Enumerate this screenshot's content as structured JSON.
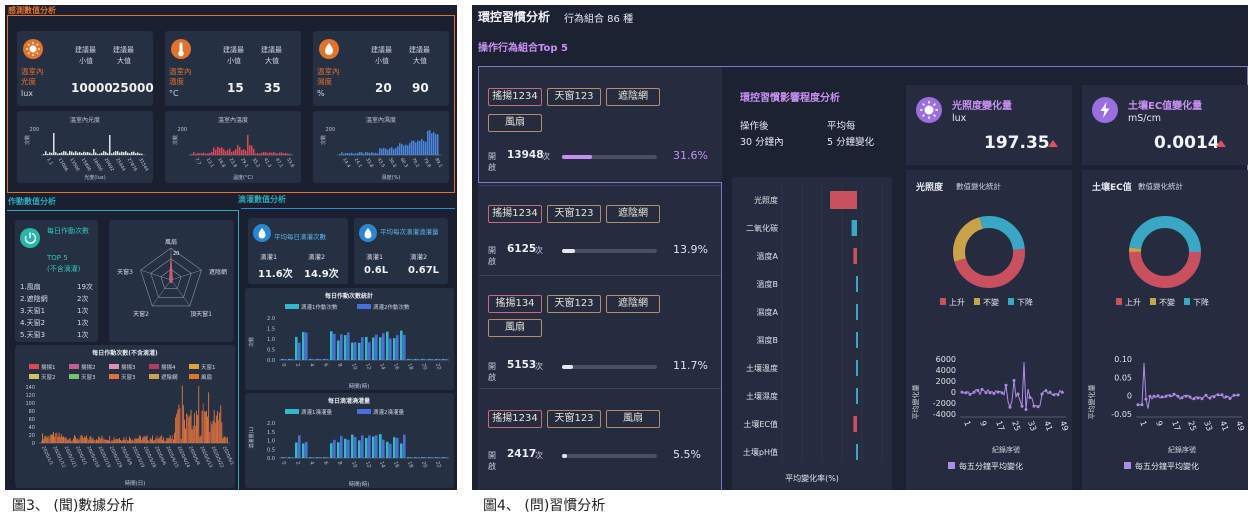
{
  "left": {
    "sec1": "感測數值分析",
    "sensors": [
      {
        "icon": "sun-icon",
        "name": "溫室內\n光度",
        "unit": "lux",
        "min": "10000",
        "max": "25000",
        "color": "#e0742e"
      },
      {
        "icon": "thermometer-icon",
        "name": "溫室內\n溫度",
        "unit": "°C",
        "min": "15",
        "max": "35",
        "color": "#e0742e"
      },
      {
        "icon": "droplet-icon",
        "name": "溫室內\n濕度",
        "unit": "%",
        "min": "20",
        "max": "90",
        "color": "#e0742e"
      }
    ],
    "minLabel": "建議最\n小值",
    "maxLabel": "建議最\n大值",
    "hist": [
      {
        "title": "溫室內光度",
        "y": "次數",
        "ytick": "200",
        "x": "光度(lux)",
        "ticks": [
          "1.1",
          "11086",
          "13500",
          "15890",
          "18400",
          "20692",
          "25944",
          "27878",
          "31544"
        ],
        "color": "#e0e0e0"
      },
      {
        "title": "溫室內溫度",
        "y": "次數",
        "ytick": "200",
        "x": "溫度(°C)",
        "ticks": [
          "7.7",
          "13.1",
          "18.8",
          "23.8",
          "29.1",
          "35.2",
          "41.3",
          "47.1",
          "53.6"
        ],
        "color": "#d9485a"
      },
      {
        "title": "溫室內濕度",
        "y": "次數",
        "ytick": "200",
        "x": "濕度(%)",
        "ticks": [
          "14.4",
          "24.1",
          "33.8",
          "43.5",
          "50.6",
          "60.3",
          "70.2",
          "79.8",
          "89.1"
        ],
        "color": "#4a86e0"
      }
    ],
    "sec2": "作動數值分析",
    "sec3": "滴灌數值分析",
    "daily": {
      "title": "每日作動次數",
      "top": "TOP 5",
      "note": "(不含滴灌)",
      "rows": [
        [
          "1.風扇",
          "19次"
        ],
        [
          "2.遮陰網",
          "2次"
        ],
        [
          "3.天窗1",
          "1次"
        ],
        [
          "4.天窗2",
          "1次"
        ],
        [
          "5.天窗3",
          "1次"
        ]
      ]
    },
    "radar": {
      "labels": [
        "風扇",
        "遮陰網",
        "頂天窗1",
        "天窗2",
        "天窗3"
      ],
      "tick": "20"
    },
    "drip": [
      {
        "title": "平均每日滴灌次數",
        "a": "滴灌1",
        "av": "11.6次",
        "b": "滴灌2",
        "bv": "14.9次"
      },
      {
        "title": "平均每次滴灌澆灌量",
        "a": "滴灌1",
        "av": "0.6L",
        "b": "滴灌2",
        "bv": "0.67L"
      }
    ],
    "bigchart": {
      "title": "每日作動次數(不含滴灌)",
      "legend": [
        "揚揚1",
        "揚揚2",
        "揚揚3",
        "揚揚4",
        "天窗1",
        "天窗2",
        "天窗3",
        "天窗3",
        "遮陰網",
        "風扇"
      ],
      "yticks": [
        "140",
        "120",
        "100",
        "80",
        "60",
        "40",
        "20",
        "0"
      ],
      "x": "時間(日)",
      "dates": [
        "2020/1/1",
        "2020/1/12",
        "2020/1/21",
        "2020/2/1",
        "2020/2/10",
        "2020/2/19",
        "2020/2/29",
        "2020/3/9",
        "2020/3/19",
        "2020/3/28",
        "2020/4/6",
        "2020/4/15",
        "2020/4/24",
        "2020/5/4",
        "2020/5/13",
        "2020/5/22",
        "2020/6/1"
      ]
    },
    "dripc1": {
      "title": "每日作動次數統計",
      "legend": [
        "滴灌1作動次數",
        "滴灌2作動次數"
      ],
      "y": "次數",
      "yticks": [
        "2.0",
        "1.5",
        "1.0",
        "0.5",
        "0.0"
      ],
      "x": "時間(時)",
      "xticks": [
        "0",
        "2",
        "4",
        "6",
        "8",
        "10",
        "12",
        "14",
        "16",
        "18",
        "20",
        "22"
      ]
    },
    "dripc2": {
      "title": "每日滴灌澆灌量",
      "legend": [
        "滴灌1澆灌量",
        "滴灌2澆灌量"
      ],
      "y": "澆灌量(L)",
      "yticks": [
        "2.0",
        "1.5",
        "1.0",
        "0.5",
        "0.0"
      ],
      "x": "時間(時)",
      "xticks": [
        "0",
        "2",
        "4",
        "6",
        "8",
        "10",
        "12",
        "14",
        "16",
        "18",
        "20",
        "22"
      ]
    },
    "caption": "圖3、 (聞)數據分析"
  },
  "right": {
    "title": "環控習慣分析",
    "count": "行為組合 86 種",
    "top5": "操作行為組合Top 5",
    "combos": [
      {
        "chips": [
          "搖揚1234",
          "天窗123",
          "遮陰網",
          "風扇"
        ],
        "label": "開啟",
        "n": "13948",
        "unit": "次",
        "pct": "31.6%",
        "frac": 0.316
      },
      {
        "chips": [
          "搖揚1234",
          "天窗123",
          "遮陰網"
        ],
        "label": "開啟",
        "n": "6125",
        "unit": "次",
        "pct": "13.9%",
        "frac": 0.139
      },
      {
        "chips": [
          "搖揚134",
          "天窗123",
          "遮陰網",
          "風扇"
        ],
        "label": "開啟",
        "n": "5153",
        "unit": "次",
        "pct": "11.7%",
        "frac": 0.117
      },
      {
        "chips": [
          "搖揚1234",
          "天窗123",
          "風扇"
        ],
        "label": "開啟",
        "n": "2417",
        "unit": "次",
        "pct": "5.5%",
        "frac": 0.055
      }
    ],
    "impact": {
      "title": "環控習慣影響程度分析",
      "after": "操作後",
      "afterv": "30 分鐘內",
      "avg": "平均每",
      "avgv": "5 分鐘變化",
      "rows": [
        "光照度",
        "二氧化碳",
        "溫度A",
        "溫度B",
        "濕度A",
        "濕度B",
        "土壤溫度",
        "土壤濕度",
        "土壤EC值",
        "土壤pH值"
      ],
      "vals": [
        0.9,
        0.18,
        0.12,
        0.1,
        0.08,
        0.06,
        0.05,
        0.05,
        0.12,
        0.03
      ],
      "x": "平均變化率(%)"
    },
    "light": {
      "title": "光照度變化量",
      "unit": "lux",
      "value": "197.35",
      "stat": "光照度",
      "statsub": "數值變化統計",
      "legend": [
        "上升",
        "不變",
        "下降"
      ],
      "y": "平均變化量",
      "yticks": [
        "6000",
        "4000",
        "2000",
        "0",
        "-2000",
        "-4000"
      ],
      "x": "紀錄序號",
      "xticks": [
        "1",
        "9",
        "17",
        "25",
        "33",
        "41",
        "49"
      ],
      "lg": "每五分鐘平均變化"
    },
    "ec": {
      "title": "土壤EC值變化量",
      "unit": "mS/cm",
      "value": "0.0014",
      "stat": "土壤EC值",
      "statsub": "數值變化統計",
      "legend": [
        "上升",
        "不變",
        "下降"
      ],
      "y": "平均變化量",
      "yticks": [
        "0.10",
        "0.05",
        "0",
        "-0.05"
      ],
      "x": "紀錄序號",
      "xticks": [
        "1",
        "9",
        "17",
        "25",
        "33",
        "41",
        "49"
      ],
      "lg": "每五分鐘平均變化"
    },
    "caption": "圖4、 (問)習慣分析"
  },
  "colors": {
    "up": "#c9505f",
    "flat": "#c9a24a",
    "down": "#3aa7c4",
    "purple": "#b08ae8",
    "orange": "#e0742e"
  }
}
